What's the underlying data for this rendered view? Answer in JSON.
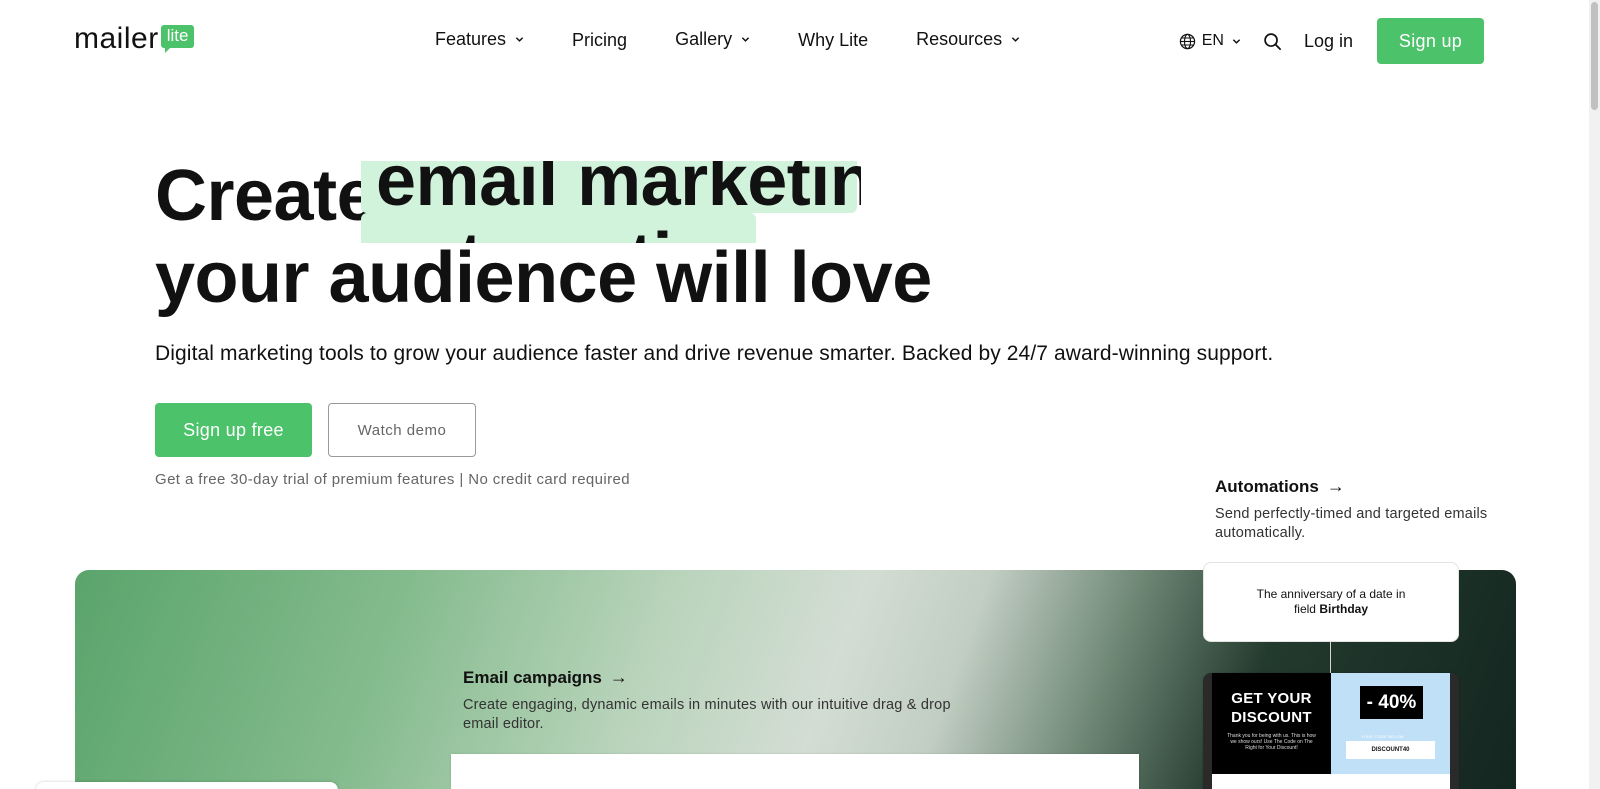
{
  "header": {
    "logo_text": "mailer",
    "logo_badge": "lite",
    "nav": {
      "features": "Features",
      "pricing": "Pricing",
      "gallery": "Gallery",
      "why_lite": "Why Lite",
      "resources": "Resources"
    },
    "language": "EN",
    "login": "Log in",
    "signup": "Sign up"
  },
  "hero": {
    "line1": "Create",
    "rotating_words": [
      "email marketing",
      "automations"
    ],
    "line2": "your audience will love",
    "subtitle": "Digital marketing tools to grow your audience faster and drive revenue smarter. Backed by 24/7 award-winning support.",
    "cta_primary": "Sign up free",
    "cta_secondary": "Watch demo",
    "trial_note": "Get a free 30-day trial of premium features | No credit card required"
  },
  "features": {
    "email_campaigns": {
      "title": "Email campaigns",
      "arrow": "→",
      "description": "Create engaging, dynamic emails in minutes with our intuitive drag & drop email editor."
    },
    "automations": {
      "title": "Automations",
      "arrow": "→",
      "description": "Send perfectly-timed and targeted emails automatically.",
      "trigger_text": "The anniversary of a date in field",
      "trigger_field": "Birthday"
    },
    "email_preview": {
      "headline": "GET YOUR DISCOUNT",
      "fine_print": "Thank you for being with us. This is how we show ours! Use The Code on The Right for Your Discount!",
      "badge": "- 40%",
      "code_label": "YOUR CODE BELOW",
      "code": "DISCOUNT40"
    }
  },
  "colors": {
    "brand_green": "#4cc26a",
    "highlight": "#d1f3dc"
  }
}
